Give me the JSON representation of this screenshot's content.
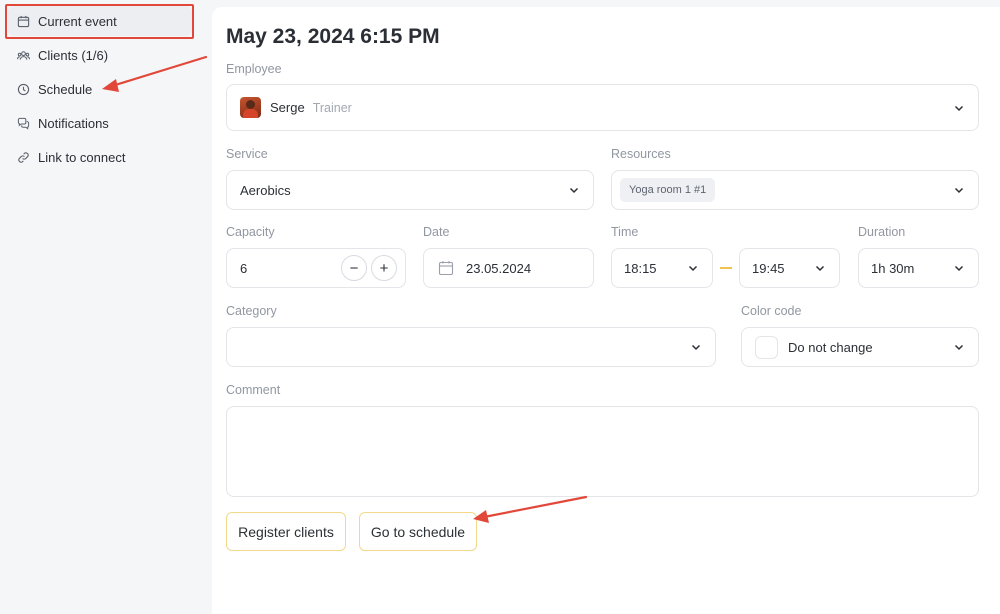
{
  "sidebar": {
    "items": [
      {
        "label": "Current event",
        "icon": "calendar-icon"
      },
      {
        "label": "Clients (1/6)",
        "icon": "users-icon"
      },
      {
        "label": "Schedule",
        "icon": "clock-icon"
      },
      {
        "label": "Notifications",
        "icon": "chat-icon"
      },
      {
        "label": "Link to connect",
        "icon": "link-icon"
      }
    ]
  },
  "event": {
    "title": "May 23, 2024 6:15 PM",
    "employee": {
      "label": "Employee",
      "name": "Serge",
      "role": "Trainer"
    },
    "service": {
      "label": "Service",
      "value": "Aerobics"
    },
    "resources": {
      "label": "Resources",
      "chip": "Yoga room 1 #1"
    },
    "capacity": {
      "label": "Capacity",
      "value": "6",
      "minus": "−",
      "plus": "+"
    },
    "date": {
      "label": "Date",
      "value": "23.05.2024"
    },
    "time": {
      "label": "Time",
      "start": "18:15",
      "end": "19:45"
    },
    "duration": {
      "label": "Duration",
      "value": "1h 30m"
    },
    "category": {
      "label": "Category",
      "value": ""
    },
    "color_code": {
      "label": "Color code",
      "value": "Do not change"
    },
    "comment": {
      "label": "Comment",
      "value": ""
    }
  },
  "buttons": {
    "register": "Register clients",
    "schedule": "Go to schedule"
  },
  "colors": {
    "annotation": "#e2483a",
    "button_border": "#f3d98a",
    "time_dash": "#f0c44c"
  }
}
